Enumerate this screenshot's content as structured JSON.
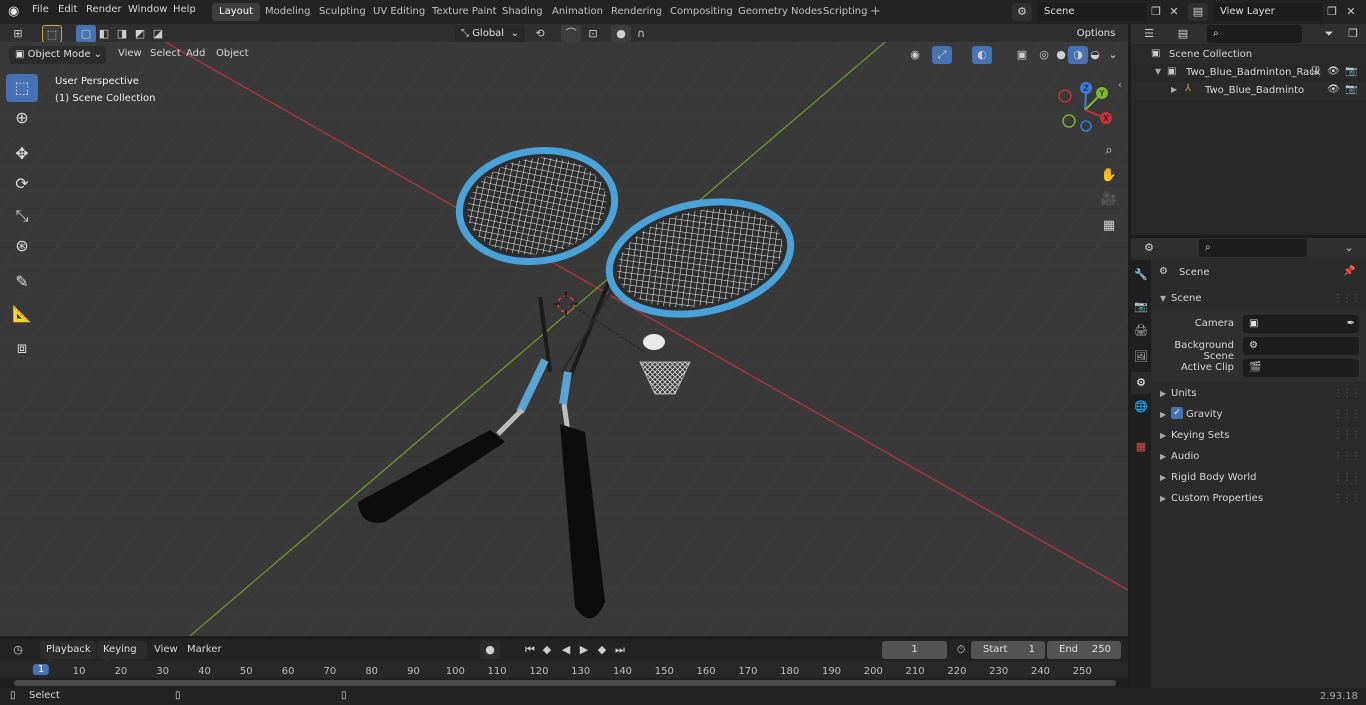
{
  "app": {
    "version": "2.93.18"
  },
  "menus": [
    "File",
    "Edit",
    "Render",
    "Window",
    "Help"
  ],
  "workspaces": [
    {
      "label": "Layout",
      "active": true
    },
    {
      "label": "Modeling"
    },
    {
      "label": "Sculpting"
    },
    {
      "label": "UV Editing"
    },
    {
      "label": "Texture Paint"
    },
    {
      "label": "Shading"
    },
    {
      "label": "Animation"
    },
    {
      "label": "Rendering"
    },
    {
      "label": "Compositing"
    },
    {
      "label": "Geometry Nodes"
    },
    {
      "label": "Scripting"
    }
  ],
  "scene_selector": {
    "value": "Scene"
  },
  "view_layer_selector": {
    "value": "View Layer"
  },
  "viewport_header": {
    "mode": "Object Mode",
    "menus": [
      "View",
      "Select",
      "Add",
      "Object"
    ],
    "transform_orientation": "Global",
    "options": "Options"
  },
  "viewport_overlay": {
    "perspective": "User Perspective",
    "collection": "(1) Scene Collection"
  },
  "axes": {
    "z": "Z",
    "y": "Y",
    "x": "X"
  },
  "outliner": {
    "root": "Scene Collection",
    "items": [
      {
        "label": "Two_Blue_Badminton_Racket",
        "level": 1
      },
      {
        "label": "Two_Blue_Badminton_Ra",
        "level": 2
      }
    ]
  },
  "properties": {
    "breadcrumb": "Scene",
    "section": "Scene",
    "fields": [
      {
        "label": "Camera",
        "value": ""
      },
      {
        "label": "Background Scene",
        "value": ""
      },
      {
        "label": "Active Clip",
        "value": ""
      }
    ],
    "panels": [
      {
        "label": "Units"
      },
      {
        "label": "Gravity",
        "checkbox": true
      },
      {
        "label": "Keying Sets"
      },
      {
        "label": "Audio"
      },
      {
        "label": "Rigid Body World"
      },
      {
        "label": "Custom Properties"
      }
    ]
  },
  "timeline": {
    "menus": [
      "Playback",
      "Keying",
      "View",
      "Marker"
    ],
    "current_frame": "1",
    "start_label": "Start",
    "start": "1",
    "end_label": "End",
    "end": "250",
    "ticks": [
      "1",
      "10",
      "20",
      "30",
      "40",
      "50",
      "60",
      "70",
      "80",
      "90",
      "100",
      "110",
      "120",
      "130",
      "140",
      "150",
      "160",
      "170",
      "180",
      "190",
      "200",
      "210",
      "220",
      "230",
      "240",
      "250"
    ]
  },
  "statusbar": {
    "left": "Select"
  },
  "colors": {
    "accent": "#4772b3",
    "racket_blue": "#4aa3d8",
    "x_axis": "#c5313d",
    "y_axis": "#7fb52e",
    "z_axis": "#3c7cd9"
  }
}
